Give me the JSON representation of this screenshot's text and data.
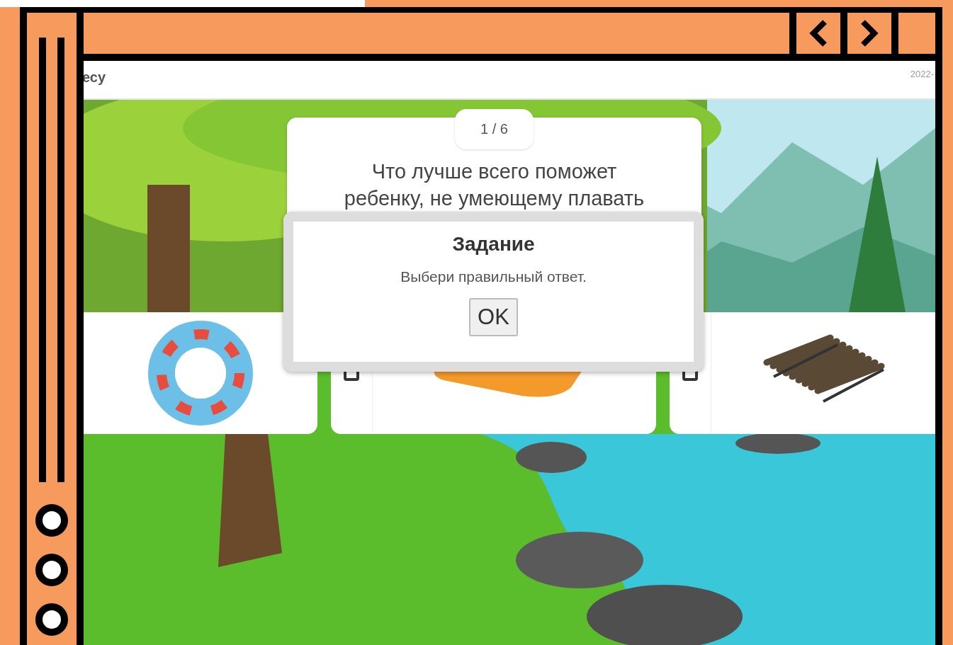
{
  "header": {
    "title": "есу",
    "date": "2022-"
  },
  "question": {
    "counter": "1 / 6",
    "text": "Что лучше всего поможет",
    "text_hidden": "ребенку, не умеющему плавать"
  },
  "answers": [
    {
      "kind": "ring"
    },
    {
      "kind": "mattress",
      "checked": false
    },
    {
      "kind": "raft",
      "checked": false
    }
  ],
  "dialog": {
    "title": "Задание",
    "message": "Выбери правильный ответ.",
    "button": "OK"
  }
}
